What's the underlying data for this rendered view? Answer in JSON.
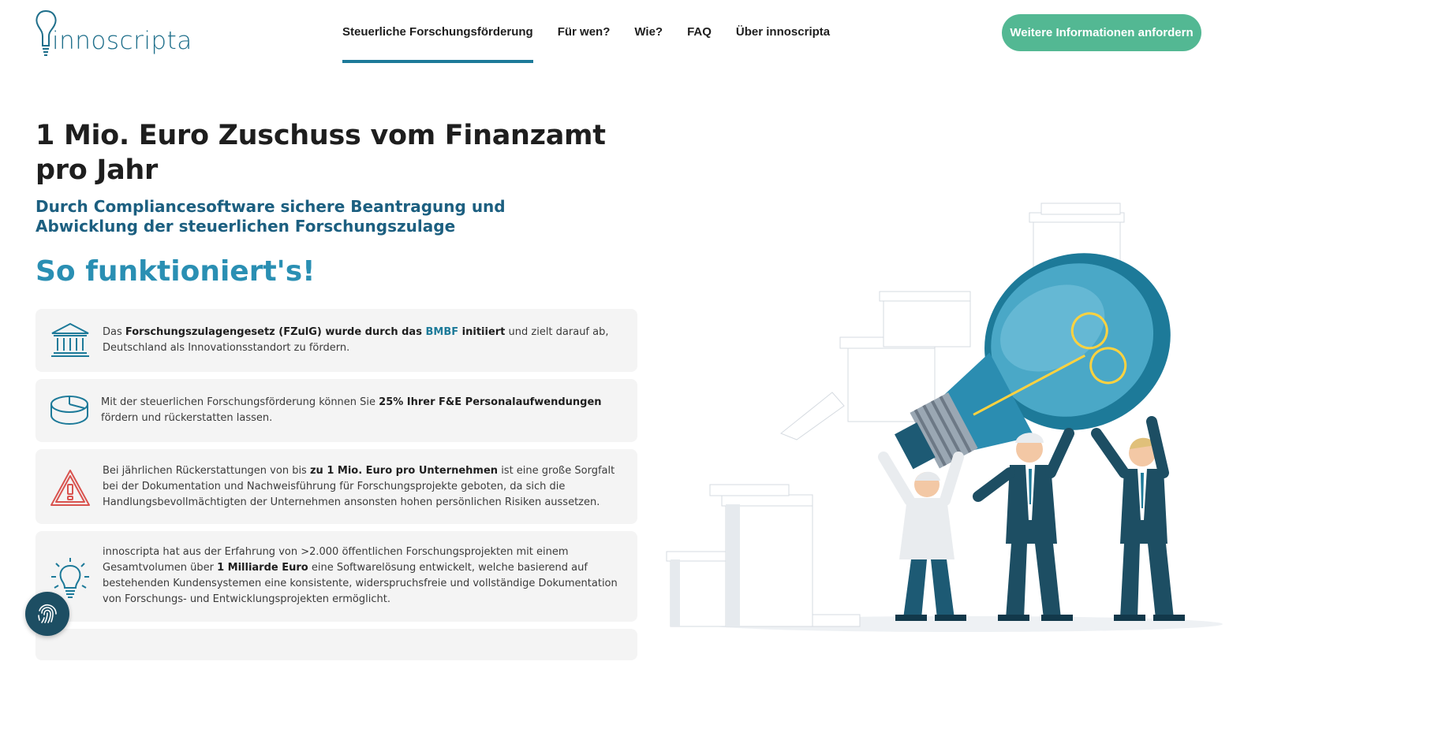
{
  "header": {
    "logo_text": "innoscripta",
    "nav": [
      {
        "label": "Steuerliche Forschungsförderung",
        "active": true
      },
      {
        "label": "Für wen?",
        "active": false
      },
      {
        "label": "Wie?",
        "active": false
      },
      {
        "label": "FAQ",
        "active": false
      },
      {
        "label": "Über innoscripta",
        "active": false
      }
    ],
    "cta_label": "Weitere Informationen anfordern"
  },
  "hero": {
    "title": "1 Mio. Euro Zuschuss vom Finanzamt pro Jahr",
    "subtitle": "Durch Compliancesoftware sichere Beantragung und Abwicklung der steuerlichen Forschungszulage",
    "how_title": "So funktioniert's!"
  },
  "cards": [
    {
      "icon": "government-building-icon",
      "t1": "Das ",
      "b1": "Forschungszulagengesetz (FZulG) wurde durch das ",
      "hl": "BMBF",
      "b2": " initiiert",
      "t2": " und zielt darauf ab, Deutschland als Innovationsstandort zu fördern."
    },
    {
      "icon": "pie-chart-icon",
      "t1": "Mit der steuerlichen Forschungsförderung können Sie ",
      "b1": "25% Ihrer F&E Personalaufwendungen",
      "t2": " fördern und rückerstatten lassen."
    },
    {
      "icon": "warning-icon",
      "t1": "Bei jährlichen Rückerstattungen von bis ",
      "b1": "zu 1 Mio. Euro pro Unternehmen",
      "t2": " ist eine große Sorgfalt bei der Dokumentation und Nachweisführung für Forschungsprojekte geboten, da sich die Handlungsbevollmächtigten der Unternehmen ansonsten hohen persönlichen Risiken aussetzen."
    },
    {
      "icon": "lightbulb-icon",
      "t1": "innoscripta hat aus der Erfahrung von >2.000 öffentlichen Forschungsprojekten mit einem Gesamtvolumen über ",
      "b1": "1 Milliarde Euro",
      "t2": " eine Softwarelösung entwickelt, welche basierend auf bestehenden Kundensystemen eine konsistente, widerspruchsfreie und vollständige Dokumentation von Forschungs- und Entwicklungsprojekten ermöglicht."
    }
  ],
  "colors": {
    "accent": "#1d7a99",
    "cta": "#53b893",
    "heading_blue": "#2a8fb3",
    "subtitle_blue": "#1c5f80",
    "warning_red": "#d9534f"
  },
  "floating": {
    "icon": "fingerprint-icon"
  }
}
